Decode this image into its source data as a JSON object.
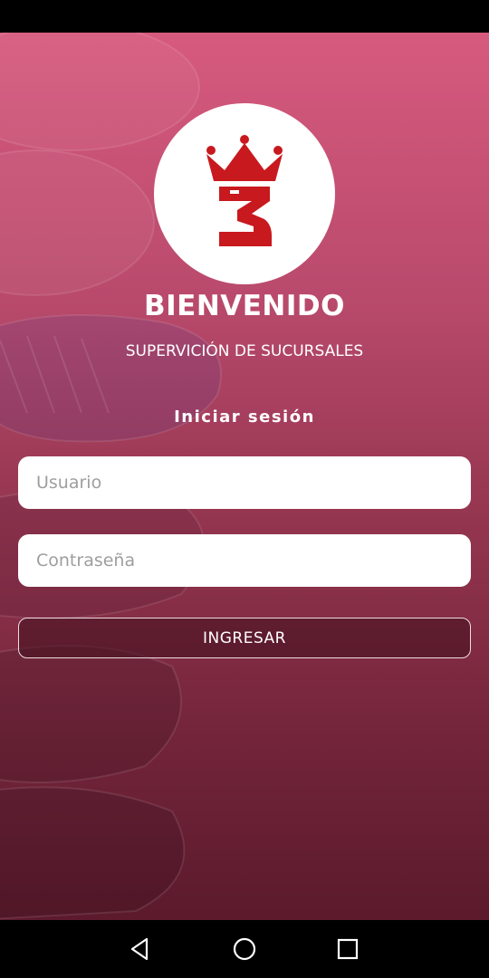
{
  "header": {
    "title": "BIENVENIDO",
    "subtitle": "SUPERVICIÓN DE SUCURSALES"
  },
  "login": {
    "heading": "Iniciar sesión",
    "username_placeholder": "Usuario",
    "username_value": "",
    "password_placeholder": "Contraseña",
    "password_value": "",
    "submit_label": "INGRESAR"
  },
  "logo": {
    "icon": "crown-3-logo",
    "color": "#c8191e",
    "background": "#ffffff"
  },
  "navigation": {
    "back_icon": "triangle-back-icon",
    "home_icon": "circle-home-icon",
    "recents_icon": "square-recents-icon"
  },
  "colors": {
    "gradient_top": "#d65a7e",
    "gradient_bottom": "#5c1a2c",
    "button_border": "#f1dce2"
  }
}
